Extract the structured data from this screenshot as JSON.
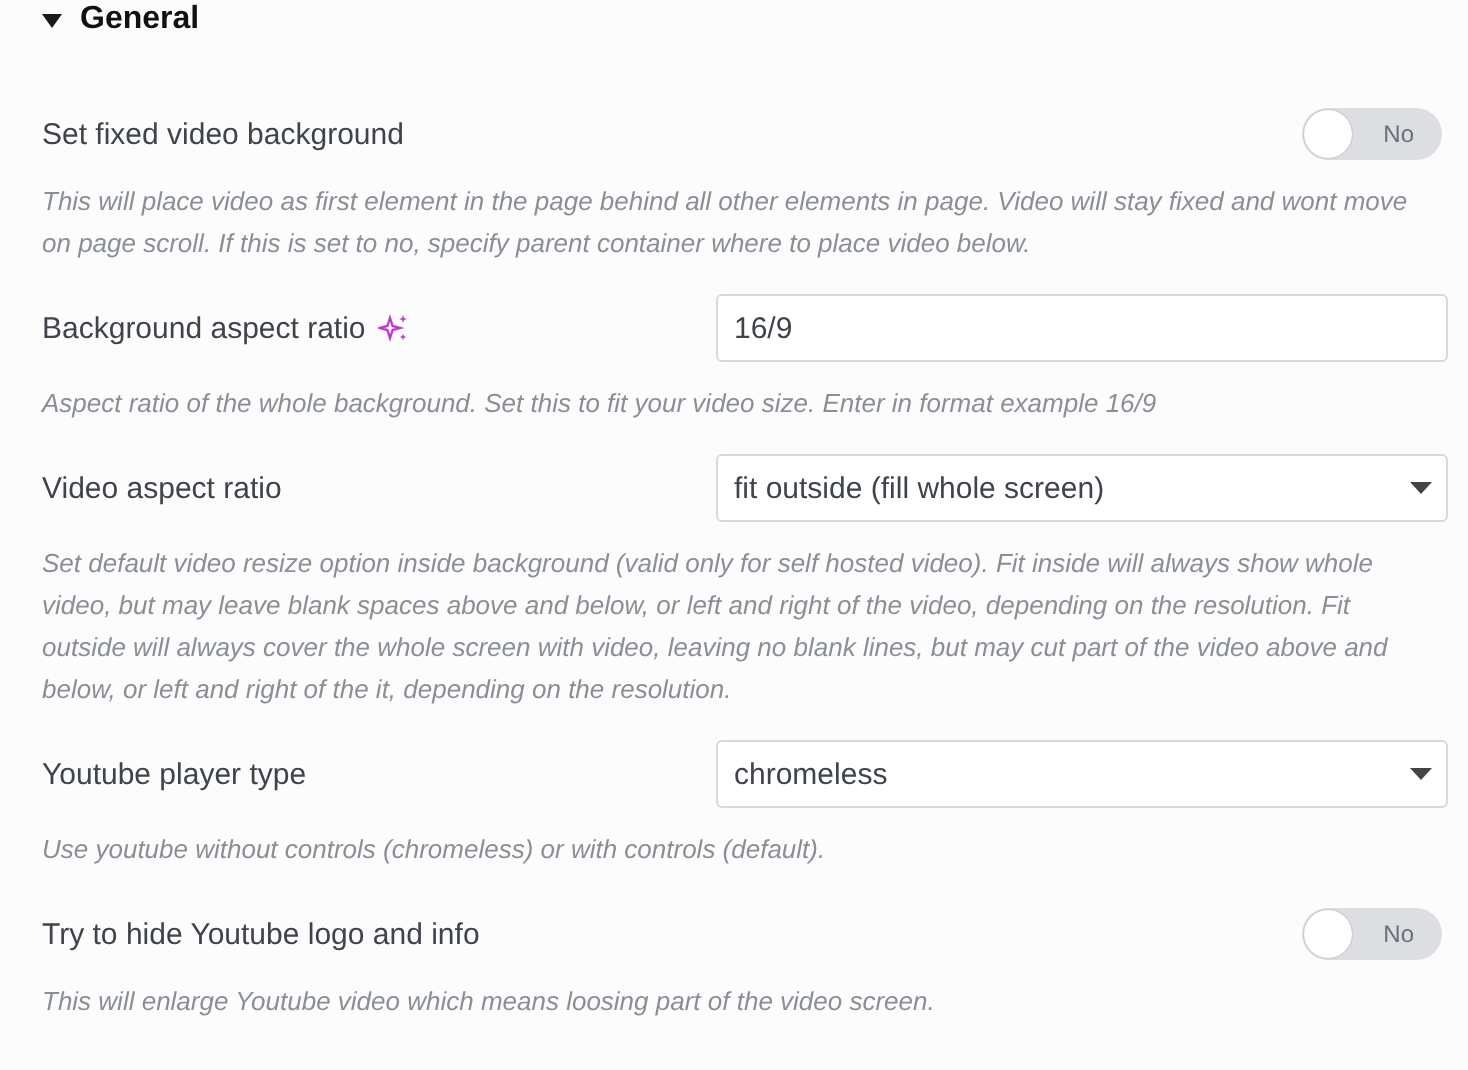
{
  "section": {
    "title": "General",
    "expanded": true
  },
  "controls": [
    {
      "kind": "switch",
      "label": "Set fixed video background",
      "on": false,
      "value_label": "No",
      "description": "This will place video as first element in the page behind all other elements in page. Video will stay fixed and wont move on page scroll. If this is set to no, specify parent container where to place video below."
    },
    {
      "kind": "text",
      "label": "Background aspect ratio",
      "ai": true,
      "value": "16/9",
      "description": "Aspect ratio of the whole background. Set this to fit your video size. Enter in format example 16/9"
    },
    {
      "kind": "select",
      "label": "Video aspect ratio",
      "value": "fit outside (fill whole screen)",
      "description": "Set default video resize option inside background (valid only for self hosted video). Fit inside will always show whole video, but may leave blank spaces above and below, or left and right of the video, depending on the resolution. Fit outside will always cover the whole screen with video, leaving no blank lines, but may cut part of the video above and below, or left and right of the it, depending on the resolution."
    },
    {
      "kind": "select",
      "label": "Youtube player type",
      "value": "chromeless",
      "description": "Use youtube without controls (chromeless) or with controls (default)."
    },
    {
      "kind": "switch",
      "label": "Try to hide Youtube logo and info",
      "on": false,
      "value_label": "No",
      "description": "This will enlarge Youtube video which means loosing part of the video screen."
    }
  ]
}
